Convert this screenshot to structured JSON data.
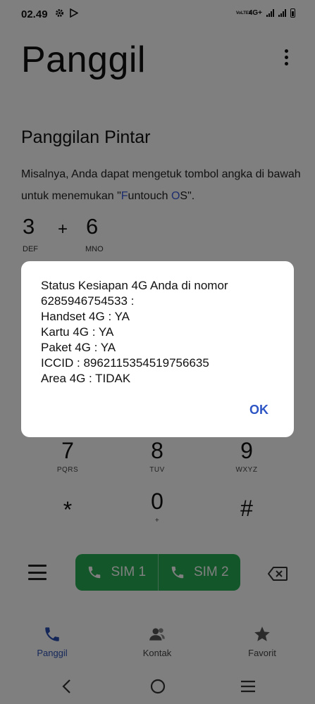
{
  "status_bar": {
    "time": "02.49",
    "network": "4G+",
    "volte": "VoLTE2"
  },
  "app": {
    "title": "Panggil"
  },
  "smart_dial": {
    "title": "Panggilan Pintar",
    "description_before": "Misalnya, Anda dapat mengetuk tombol angka di bawah untuk menemukan \"",
    "description_f": "F",
    "description_mid": "untouch ",
    "description_o": "O",
    "description_after": "S\".",
    "example": [
      {
        "digit": "3",
        "letters": "DEF"
      },
      {
        "digit": "6",
        "letters": "MNO"
      }
    ],
    "plus": "+"
  },
  "keypad": [
    {
      "digit": "7",
      "letters": "PQRS"
    },
    {
      "digit": "8",
      "letters": "TUV"
    },
    {
      "digit": "9",
      "letters": "WXYZ"
    },
    {
      "digit": "*",
      "letters": ""
    },
    {
      "digit": "0",
      "letters": "+"
    },
    {
      "digit": "#",
      "letters": ""
    }
  ],
  "call_buttons": {
    "sim1": "SIM 1",
    "sim2": "SIM 2"
  },
  "bottom_nav": [
    {
      "label": "Panggil",
      "icon": "phone-icon"
    },
    {
      "label": "Kontak",
      "icon": "contacts-icon"
    },
    {
      "label": "Favorit",
      "icon": "star-icon"
    }
  ],
  "dialog": {
    "lines": [
      "Status Kesiapan 4G Anda di nomor",
      "6285946754533 :",
      "Handset 4G : YA",
      "Kartu 4G : YA",
      "Paket 4G : YA",
      "ICCID : 8962115354519756635",
      "Area 4G : TIDAK"
    ],
    "ok_label": "OK"
  },
  "colors": {
    "accent": "#2d55c4",
    "call_green": "#26ad52",
    "scrim": "rgba(0,0,0,0.5)"
  }
}
